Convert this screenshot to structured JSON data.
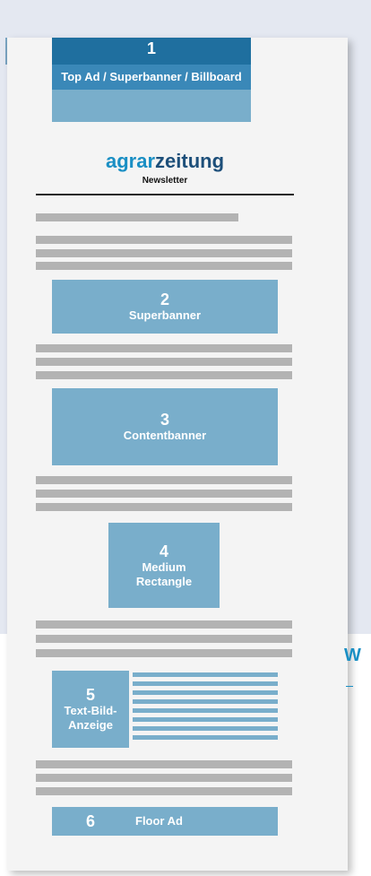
{
  "brand": {
    "part1": "agrar",
    "part2": "zeitung",
    "subtitle": "Newsletter"
  },
  "ads": [
    {
      "num": "1",
      "label": "Top Ad / Superbanner / Billboard"
    },
    {
      "num": "2",
      "label": "Superbanner"
    },
    {
      "num": "3",
      "label": "Contentbanner"
    },
    {
      "num": "4",
      "label": "Medium Rectangle"
    },
    {
      "num": "5",
      "label": "Text-Bild-Anzeige"
    },
    {
      "num": "6",
      "label": "Floor Ad"
    }
  ],
  "edge_text": "W",
  "colors": {
    "ad": "#79aecb",
    "ad_dark": "#1f6f9f",
    "brand_light": "#1a8fc4",
    "brand_dark": "#1d4f7a",
    "text_line": "#b3b3b3"
  }
}
